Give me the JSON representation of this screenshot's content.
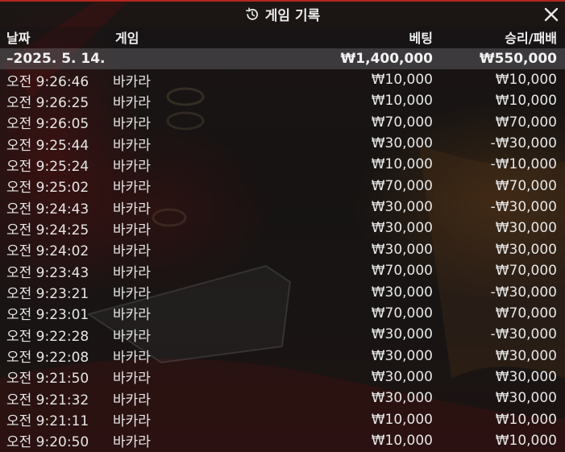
{
  "header": {
    "title": "게임 기록",
    "icon": "history-icon",
    "close_icon": "close-icon"
  },
  "columns": {
    "date": "날짜",
    "game": "게임",
    "bet": "베팅",
    "win_loss": "승리/패배"
  },
  "summary": {
    "date": "–2025. 5. 14.",
    "bet": "₩1,400,000",
    "win_loss": "₩550,000"
  },
  "rows": [
    {
      "time": "오전 9:26:46",
      "game": "바카라",
      "bet": "₩10,000",
      "win_loss": "₩10,000"
    },
    {
      "time": "오전 9:26:25",
      "game": "바카라",
      "bet": "₩10,000",
      "win_loss": "₩10,000"
    },
    {
      "time": "오전 9:26:05",
      "game": "바카라",
      "bet": "₩70,000",
      "win_loss": "₩70,000"
    },
    {
      "time": "오전 9:25:44",
      "game": "바카라",
      "bet": "₩30,000",
      "win_loss": "-₩30,000"
    },
    {
      "time": "오전 9:25:24",
      "game": "바카라",
      "bet": "₩10,000",
      "win_loss": "-₩10,000"
    },
    {
      "time": "오전 9:25:02",
      "game": "바카라",
      "bet": "₩70,000",
      "win_loss": "₩70,000"
    },
    {
      "time": "오전 9:24:43",
      "game": "바카라",
      "bet": "₩30,000",
      "win_loss": "-₩30,000"
    },
    {
      "time": "오전 9:24:25",
      "game": "바카라",
      "bet": "₩30,000",
      "win_loss": "₩30,000"
    },
    {
      "time": "오전 9:24:02",
      "game": "바카라",
      "bet": "₩30,000",
      "win_loss": "₩30,000"
    },
    {
      "time": "오전 9:23:43",
      "game": "바카라",
      "bet": "₩70,000",
      "win_loss": "₩70,000"
    },
    {
      "time": "오전 9:23:21",
      "game": "바카라",
      "bet": "₩30,000",
      "win_loss": "-₩30,000"
    },
    {
      "time": "오전 9:23:01",
      "game": "바카라",
      "bet": "₩70,000",
      "win_loss": "₩70,000"
    },
    {
      "time": "오전 9:22:28",
      "game": "바카라",
      "bet": "₩30,000",
      "win_loss": "-₩30,000"
    },
    {
      "time": "오전 9:22:08",
      "game": "바카라",
      "bet": "₩30,000",
      "win_loss": "₩30,000"
    },
    {
      "time": "오전 9:21:50",
      "game": "바카라",
      "bet": "₩30,000",
      "win_loss": "₩30,000"
    },
    {
      "time": "오전 9:21:32",
      "game": "바카라",
      "bet": "₩30,000",
      "win_loss": "₩30,000"
    },
    {
      "time": "오전 9:21:11",
      "game": "바카라",
      "bet": "₩10,000",
      "win_loss": "₩10,000"
    },
    {
      "time": "오전 9:20:50",
      "game": "바카라",
      "bet": "₩10,000",
      "win_loss": "₩10,000"
    }
  ],
  "colors": {
    "accent_top_border": "#b3261e",
    "text": "#e6e6e6",
    "summary_bg": "#5a5a5f"
  }
}
